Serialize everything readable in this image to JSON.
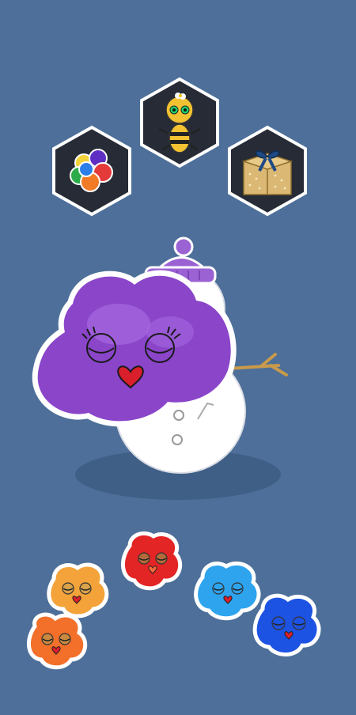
{
  "game": {
    "background_color": "#4d6f99",
    "menu_items": [
      {
        "name": "color-palette-icon",
        "kind": "hex-button"
      },
      {
        "name": "bee-icon",
        "kind": "hex-button"
      },
      {
        "name": "gift-box-icon",
        "kind": "hex-button"
      }
    ],
    "main_character": {
      "name": "purple-slime",
      "color": "#8a45c9",
      "state": "sleeping"
    },
    "snowman": {
      "hat_color": "#9a62d3"
    },
    "slime_tray": [
      {
        "name": "orange-light-slime",
        "color": "#f3a33a"
      },
      {
        "name": "orange-slime",
        "color": "#f2702a"
      },
      {
        "name": "red-slime",
        "color": "#e42525"
      },
      {
        "name": "light-blue-slime",
        "color": "#2ea4ee"
      },
      {
        "name": "blue-slime",
        "color": "#1d53e2"
      }
    ]
  }
}
